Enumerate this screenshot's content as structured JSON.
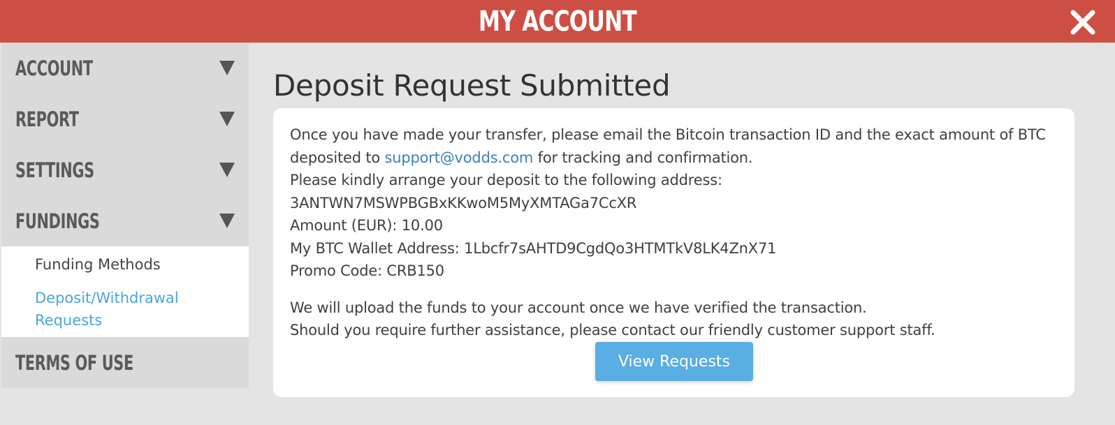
{
  "header": {
    "title": "MY ACCOUNT",
    "close_icon": "close-icon",
    "background_color": "#cd4f44"
  },
  "sidebar": {
    "items": [
      {
        "label": "ACCOUNT",
        "icon": "triangle-down-icon"
      },
      {
        "label": "REPORT",
        "icon": "triangle-down-icon"
      },
      {
        "label": "SETTINGS",
        "icon": "triangle-down-icon"
      },
      {
        "label": "FUNDINGS",
        "icon": "triangle-down-icon"
      }
    ],
    "fundings_submenu": [
      {
        "label": "Funding Methods"
      },
      {
        "label": "Deposit/Withdrawal Requests",
        "label_line1": "Deposit/Withdrawal",
        "label_line2": "Requests"
      }
    ],
    "terms": {
      "label": "TERMS OF USE"
    }
  },
  "main": {
    "title": "Deposit Request Submitted",
    "message": {
      "line1": "Once you have made your transfer, please email the Bitcoin transaction ID and the exact amount of BTC",
      "line2_prefix": "deposited to ",
      "support_email": "support@vodds.com",
      "line2_suffix": " for tracking and confirmation.",
      "line3": "Please kindly arrange your deposit to the following address:",
      "deposit_address": "3ANTWN7MSWPBGBxKKwoM5MyXMTAGa7CcXR",
      "amount_label": "Amount (EUR): ",
      "amount_value": "10.00",
      "wallet_label": "My BTC Wallet Address: ",
      "wallet_value": "1Lbcfr7sAHTD9CgdQo3HTMTkV8LK4ZnX71",
      "promo_label": "Promo Code: ",
      "promo_value": "CRB150",
      "footer_line1": "We will upload the funds to your account once we have verified the transaction.",
      "footer_line2": "Should you require further assistance, please contact our friendly customer support staff."
    },
    "view_requests_button": "View Requests"
  },
  "colors": {
    "accent_blue": "#59aee3",
    "link_blue": "#3a7fc4",
    "active_submenu": "#4aa5dd"
  }
}
